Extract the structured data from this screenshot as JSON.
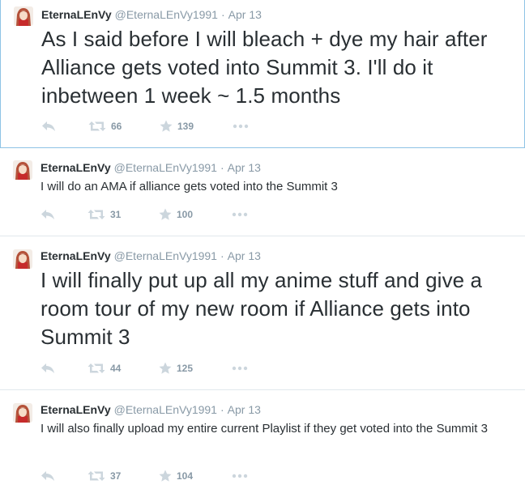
{
  "tweets": [
    {
      "name": "EternaLEnVy",
      "handle": "@EternaLEnVy1991",
      "separator": "·",
      "date": "Apr 13",
      "text": "As I said before I will bleach + dye my hair after Alliance gets voted into Summit 3. I'll do it inbetween 1 week ~ 1.5 months",
      "retweets": "66",
      "favorites": "139"
    },
    {
      "name": "EternaLEnVy",
      "handle": "@EternaLEnVy1991",
      "separator": "·",
      "date": "Apr 13",
      "text": "I will do an AMA if alliance gets voted into the Summit 3",
      "retweets": "31",
      "favorites": "100"
    },
    {
      "name": "EternaLEnVy",
      "handle": "@EternaLEnVy1991",
      "separator": "·",
      "date": "Apr 13",
      "text": "I will finally put up all my anime stuff and give a room tour of my new room if Alliance gets into Summit 3",
      "retweets": "44",
      "favorites": "125"
    },
    {
      "name": "EternaLEnVy",
      "handle": "@EternaLEnVy1991",
      "separator": "·",
      "date": "Apr 13",
      "text": "I will also finally upload my entire current Playlist if they get voted into the Summit 3",
      "retweets": "37",
      "favorites": "104"
    }
  ],
  "colors": {
    "text": "#292f33",
    "muted": "#8899a6",
    "icon": "#ccd6dd",
    "highlight_border": "#8ec3e5",
    "divider": "#e1e8ed"
  }
}
